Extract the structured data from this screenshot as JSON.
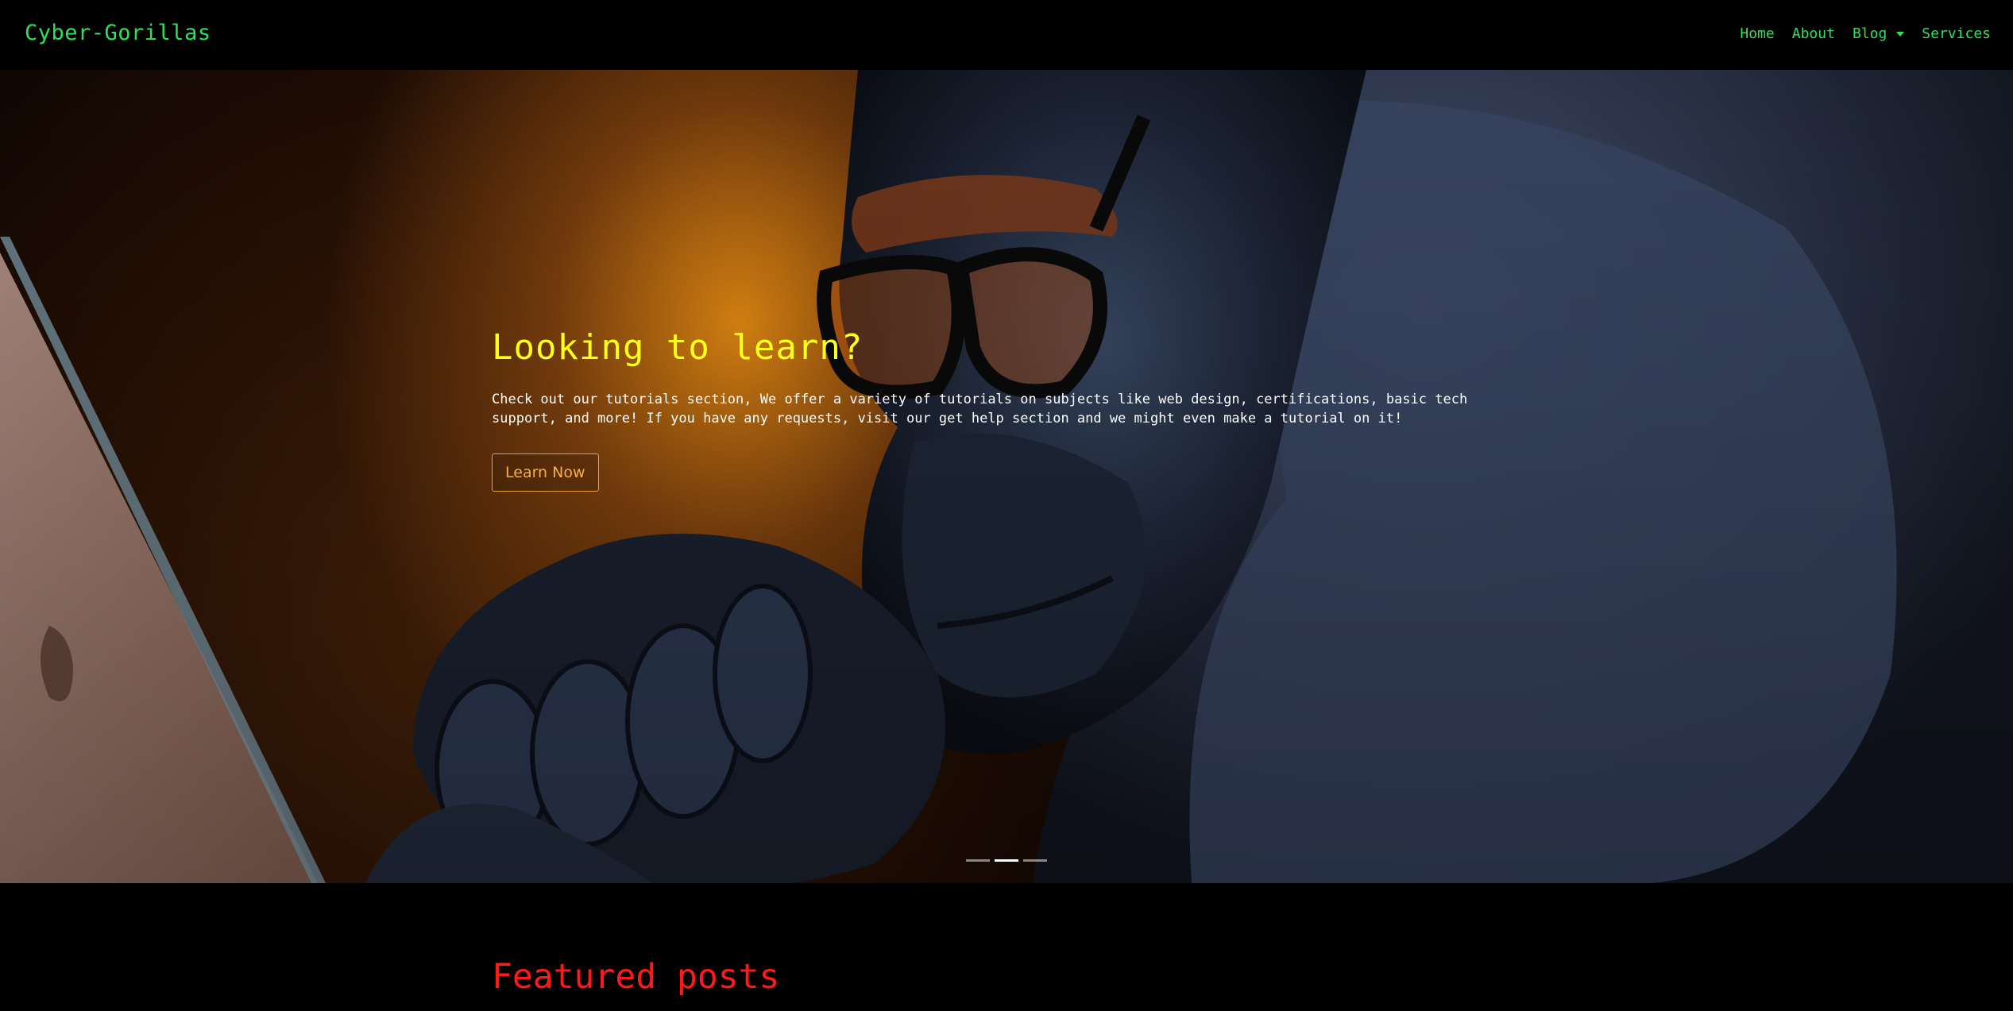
{
  "brand": "Cyber-Gorillas",
  "nav": {
    "home": "Home",
    "about": "About",
    "blog": "Blog",
    "services": "Services"
  },
  "hero": {
    "heading": "Looking to learn?",
    "text": "Check out our tutorials section, We offer a variety of tutorials on subjects like web design, certifications, basic tech support, and more! If you have any requests, visit our get help section and we might even make a tutorial on it!",
    "button": "Learn Now",
    "slides_total": 3,
    "active_slide": 2
  },
  "section": {
    "title": "Featured posts"
  },
  "colors": {
    "nav_text": "#2ee05a",
    "heading": "#ffff1a",
    "button": "#f4b043",
    "featured": "#ff1a1a"
  }
}
